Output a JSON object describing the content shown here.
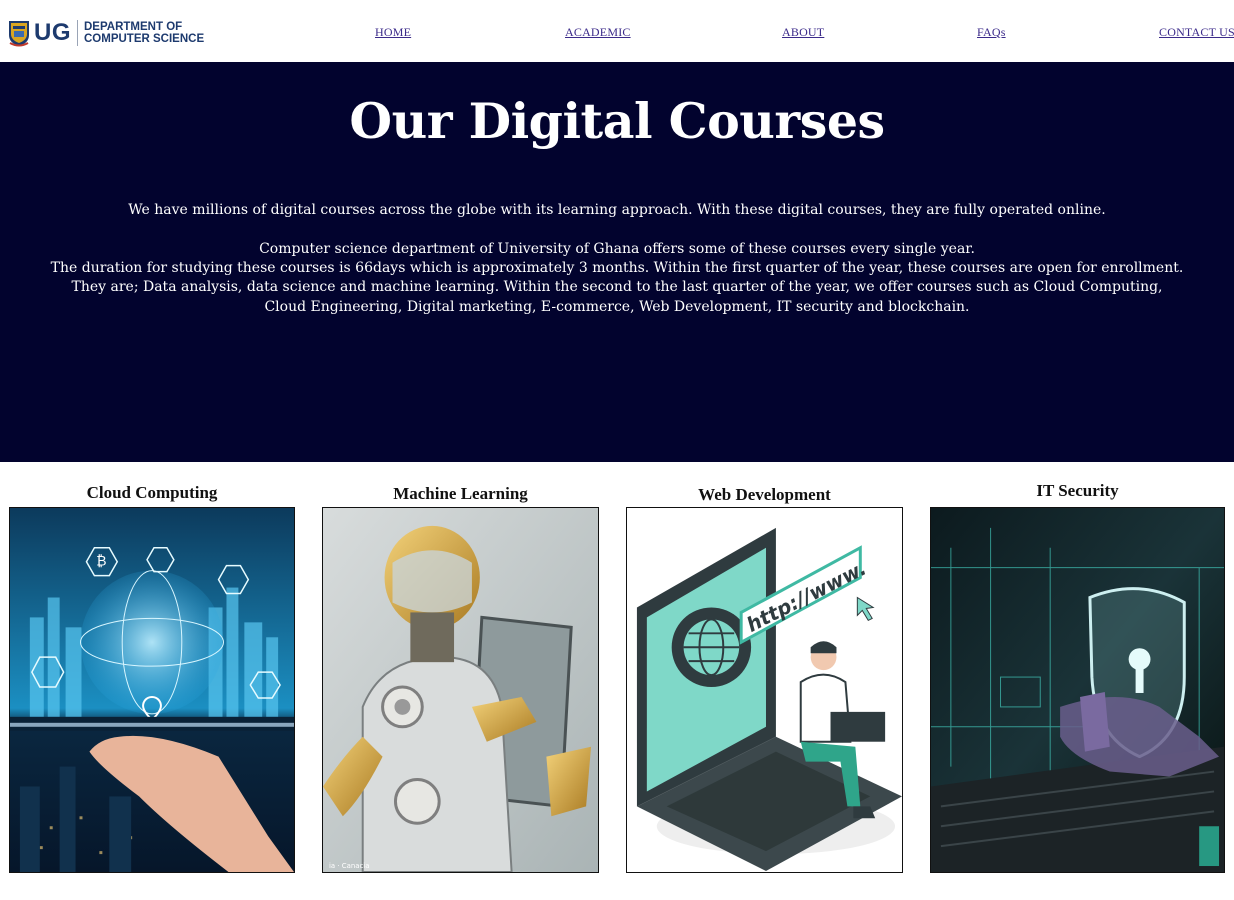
{
  "header": {
    "logo": {
      "abbr": "UG",
      "line1": "DEPARTMENT OF",
      "line2": "COMPUTER SCIENCE",
      "icon": "university-crest-icon"
    },
    "nav": [
      {
        "label": "HOME"
      },
      {
        "label": "ACADEMIC"
      },
      {
        "label": "ABOUT"
      },
      {
        "label": "FAQs"
      },
      {
        "label": "CONTACT US"
      }
    ],
    "link_color": "#3b2a8a"
  },
  "hero": {
    "title": "Our Digital Courses",
    "intro": "We have millions of digital courses across the globe with its learning approach. With these digital courses, they are fully operated online.",
    "body": [
      "Computer science department of University of Ghana offers some of these courses every single year.",
      "The duration for studying these courses is 66days which is approximately 3 months. Within the first quarter of the year, these courses are open for enrollment.",
      "They are; Data analysis, data science and machine learning. Within the second to the last quarter of the year, we offer courses such as Cloud Computing,",
      "Cloud Engineering, Digital marketing, E-commerce, Web Development, IT security and blockchain."
    ],
    "background": "#02032e"
  },
  "courses": [
    {
      "title": "Cloud Computing",
      "image": "cloud-computing-image"
    },
    {
      "title": "Machine Learning",
      "image": "robot-image"
    },
    {
      "title": "Web Development",
      "image": "laptop-www-image"
    },
    {
      "title": "IT Security",
      "image": "security-shield-image"
    }
  ]
}
